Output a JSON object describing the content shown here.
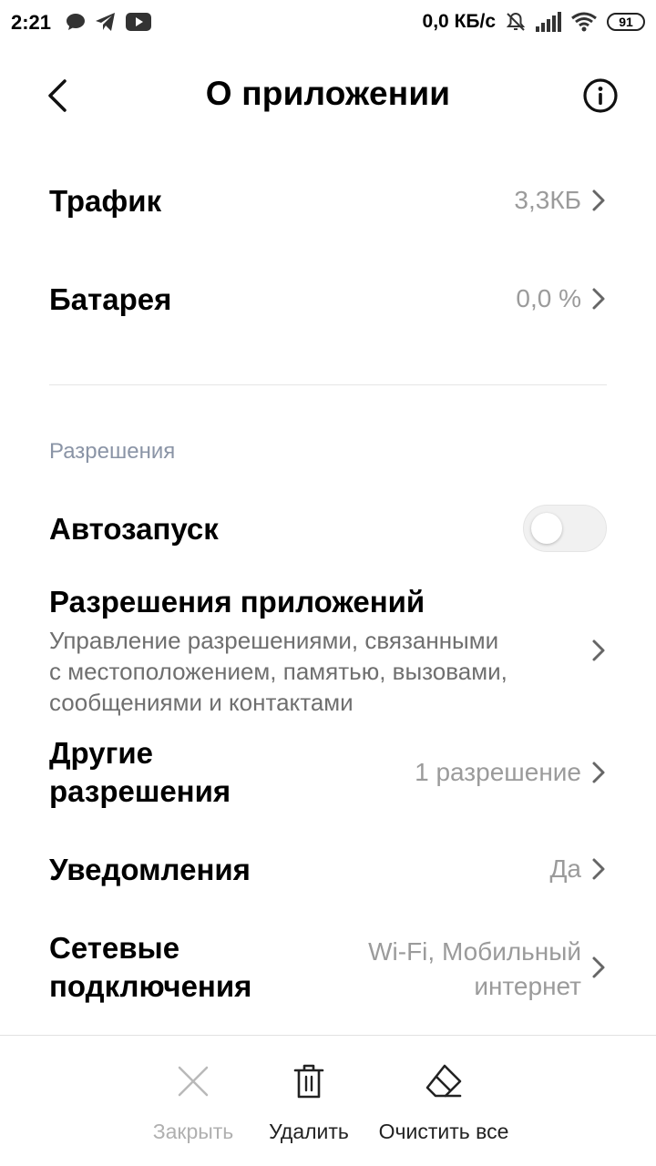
{
  "status_bar": {
    "time": "2:21",
    "left_icons": [
      "chat-bubble-icon",
      "telegram-icon",
      "youtube-icon"
    ],
    "network_speed": "0,0 КБ/с",
    "right_icons": [
      "bell-off-icon",
      "signal-icon",
      "wifi-icon"
    ],
    "battery": "91"
  },
  "header": {
    "title": "О приложении",
    "back_icon": "arrow-back-icon",
    "info_icon": "info-icon"
  },
  "usage": {
    "traffic": {
      "label": "Трафик",
      "value": "3,3КБ"
    },
    "battery": {
      "label": "Батарея",
      "value": "0,0 %"
    }
  },
  "permissions": {
    "section_title": "Разрешения",
    "autostart": {
      "label": "Автозапуск",
      "enabled": false
    },
    "app_permissions": {
      "label": "Разрешения приложений",
      "description_lines": [
        "Управление разрешениями, связанными",
        "с местоположением, памятью, вызовами,",
        "сообщениями и контактами"
      ]
    },
    "other_permissions": {
      "label_lines": [
        "Другие",
        "разрешения"
      ],
      "value": "1 разрешение"
    },
    "notifications": {
      "label": "Уведомления",
      "value": "Да"
    },
    "network": {
      "label_lines": [
        "Сетевые",
        "подключения"
      ],
      "value_lines": [
        "Wi-Fi, Мобильный",
        "интернет"
      ]
    }
  },
  "bottom_bar": {
    "close": {
      "label": "Закрыть",
      "enabled": false
    },
    "delete": {
      "label": "Удалить"
    },
    "clear_all": {
      "label": "Очистить все"
    }
  },
  "colors": {
    "text_primary": "#000000",
    "text_secondary": "#9b9b9b",
    "section_header": "#8a94a6",
    "divider": "#e5e5e5"
  }
}
